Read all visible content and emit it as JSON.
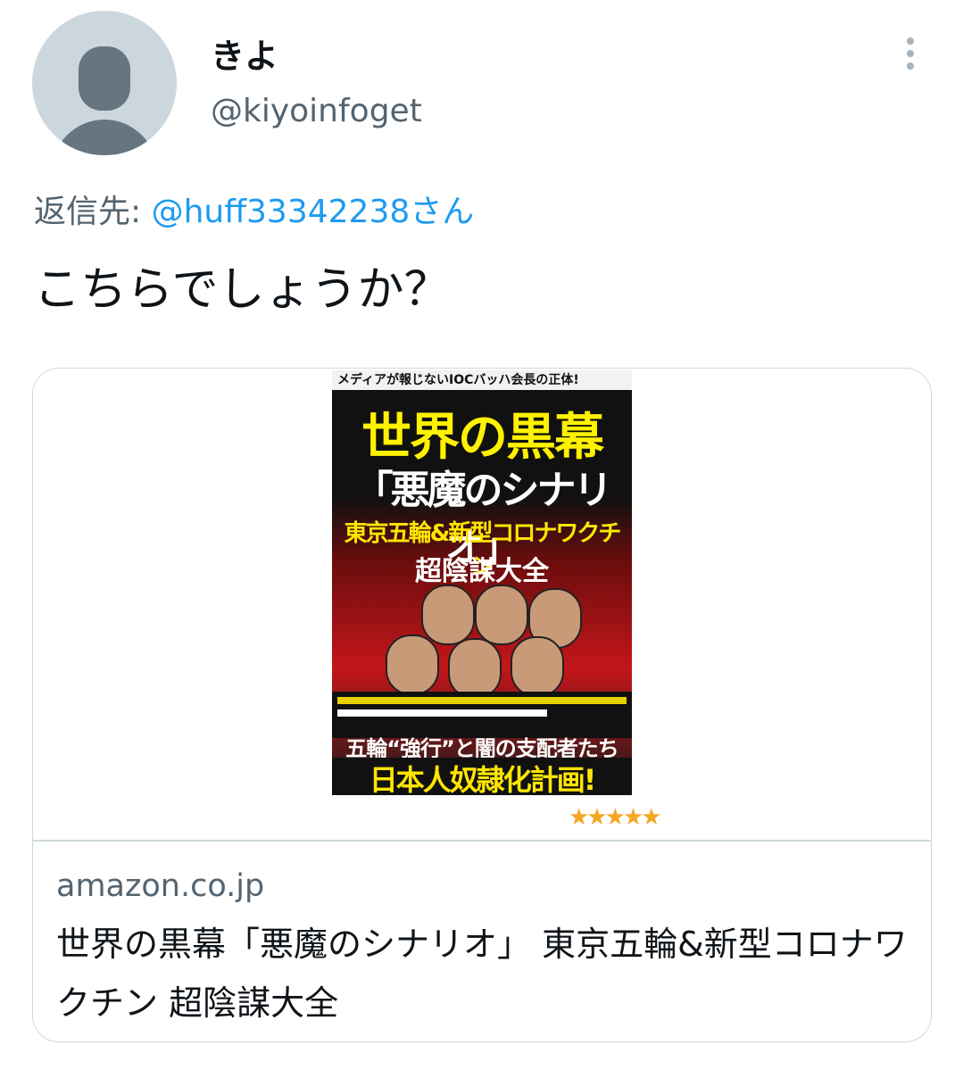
{
  "author": {
    "name": "きよ",
    "handle": "@kiyoinfoget",
    "avatar_icon": "default-profile-icon"
  },
  "more_icon": "vertical-dots-icon",
  "reply": {
    "prefix": "返信先: ",
    "mention": "@huff33342238さん"
  },
  "tweet": {
    "text": "こちらでしょうか？"
  },
  "card": {
    "cover": {
      "strap": "メディアが報じないIOCバッハ会長の正体!",
      "title": "世界の黒幕",
      "subtitle": "「悪魔のシナリオ」",
      "line3": "東京五輪&新型コロナワクチン",
      "line4": "超陰謀大全",
      "tagline": "五輪“強行”と闇の支配者たち",
      "headline": "日本人奴隷化計画!"
    },
    "rating": "★★★★★",
    "domain": "amazon.co.jp",
    "title": "世界の黒幕「悪魔のシナリオ」 東京五輪&新型コロナワクチン 超陰謀大全"
  },
  "colors": {
    "link": "#1d9bf0",
    "secondary_text": "#536471",
    "border": "#cfd9de",
    "star": "#f5a623"
  }
}
